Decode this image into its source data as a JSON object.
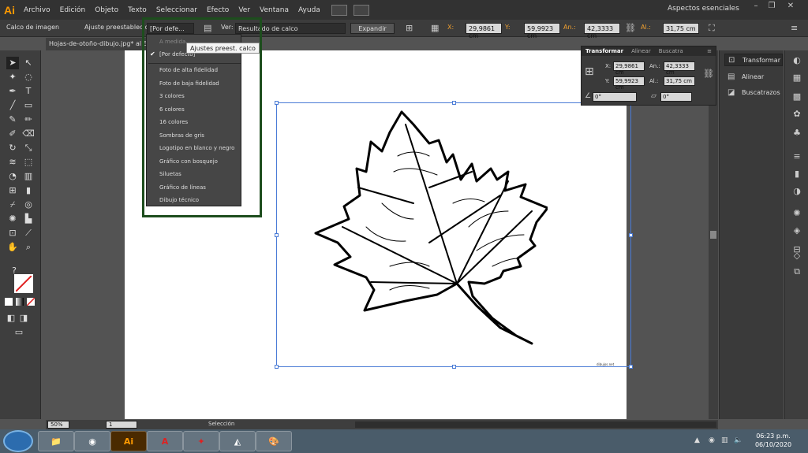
{
  "menubar": {
    "logo": "Ai",
    "items": [
      "Archivo",
      "Edición",
      "Objeto",
      "Texto",
      "Seleccionar",
      "Efecto",
      "Ver",
      "Ventana",
      "Ayuda"
    ],
    "workspace": "Aspectos esenciales"
  },
  "controlbar": {
    "title": "Calco de imagen",
    "preset_label": "Ajuste preestablecido:",
    "preset_value": "[Por defe...",
    "view_label": "Ver:",
    "view_value": "Resultado de calco",
    "expand_button": "Expandir",
    "x_label": "X:",
    "x_value": "29,9861 cm",
    "y_label": "Y:",
    "y_value": "59,9923 cm",
    "w_label": "An.:",
    "w_value": "42,3333 cm",
    "h_label": "Al.:",
    "h_value": "31,75 cm"
  },
  "document": {
    "tab_title": "Hojas-de-otoño-dibujo.jpg* al 5"
  },
  "preset_dropdown": {
    "tooltip": "Ajustes preest. calco",
    "items": [
      {
        "label": "A medida",
        "disabled": true
      },
      {
        "label": "[Por defecto]",
        "checked": true
      },
      {
        "label": "Foto de alta fidelidad"
      },
      {
        "label": "Foto de baja fidelidad"
      },
      {
        "label": "3 colores"
      },
      {
        "label": "6 colores"
      },
      {
        "label": "16 colores"
      },
      {
        "label": "Sombras de gris"
      },
      {
        "label": "Logotipo en blanco y negro"
      },
      {
        "label": "Gráfico con bosquejo"
      },
      {
        "label": "Siluetas"
      },
      {
        "label": "Gráfico de líneas"
      },
      {
        "label": "Dibujo técnico"
      }
    ]
  },
  "transform_panel": {
    "tabs": [
      "Transformar",
      "Alinear",
      "Buscatra"
    ],
    "x_label": "X:",
    "x_value": "29,9861 cm",
    "y_label": "Y:",
    "y_value": "59,9923 cm",
    "w_label": "An.:",
    "w_value": "42,3333 cm",
    "h_label": "Al.:",
    "h_value": "31,75 cm",
    "rotate_value": "0°",
    "shear_value": "0°"
  },
  "right_panel": {
    "items": [
      "Transformar",
      "Alinear",
      "Buscatrazos"
    ]
  },
  "statusbar": {
    "zoom": "50%",
    "artboard": "1",
    "tool": "Selección"
  },
  "artboard": {
    "watermark": "dibujos.net"
  },
  "taskbar": {
    "time": "06:23 p.m.",
    "date": "06/10/2020",
    "ai_label": "Ai"
  }
}
